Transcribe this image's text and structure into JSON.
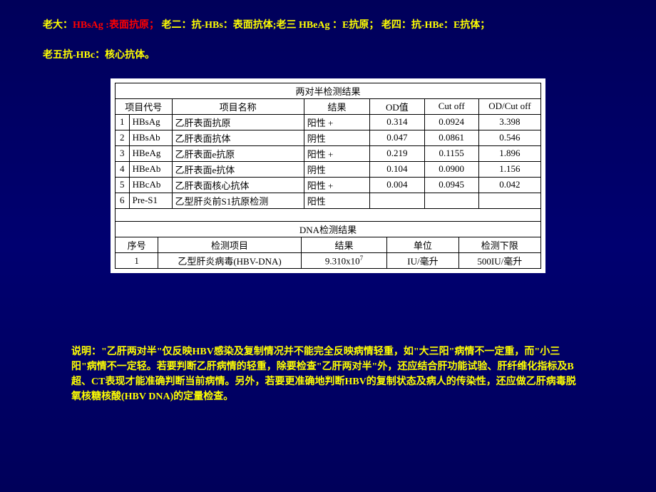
{
  "header": {
    "item1_label": "老大：",
    "item1_code": "HBsAg :表面抗原",
    "item1_sep": "；",
    "item2": "   老二：抗-HBs：表面抗体;",
    "item3": "老三 HBeAg ：E抗原；",
    "item4": "   老四：抗-HBe：E抗体；",
    "item5": "老五抗-HBc：核心抗体。"
  },
  "table1": {
    "title": "两对半检测结果",
    "headers": {
      "code": "项目代号",
      "name": "项目名称",
      "result": "结果",
      "od": "OD值",
      "cutoff": "Cut off",
      "ratio": "OD/Cut off"
    },
    "rows": [
      {
        "num": "1",
        "code": "HBsAg",
        "name": "乙肝表面抗原",
        "result": "阳性 +",
        "od": "0.314",
        "cutoff": "0.0924",
        "ratio": "3.398"
      },
      {
        "num": "2",
        "code": "HBsAb",
        "name": "乙肝表面抗体",
        "result": "阴性",
        "od": "0.047",
        "cutoff": "0.0861",
        "ratio": "0.546"
      },
      {
        "num": "3",
        "code": "HBeAg",
        "name": "乙肝表面e抗原",
        "result": "阳性 +",
        "od": "0.219",
        "cutoff": "0.1155",
        "ratio": "1.896"
      },
      {
        "num": "4",
        "code": "HBeAb",
        "name": "乙肝表面e抗体",
        "result": "阴性",
        "od": "0.104",
        "cutoff": "0.0900",
        "ratio": "1.156"
      },
      {
        "num": "5",
        "code": "HBcAb",
        "name": "乙肝表面核心抗体",
        "result": "阳性 +",
        "od": "0.004",
        "cutoff": "0.0945",
        "ratio": "0.042"
      },
      {
        "num": "6",
        "code": "Pre-S1",
        "name": "乙型肝炎前S1抗原检测",
        "result": "阳性",
        "od": "",
        "cutoff": "",
        "ratio": ""
      }
    ]
  },
  "table2": {
    "title": "DNA检测结果",
    "headers": {
      "seq": "序号",
      "item": "检测项目",
      "result": "结果",
      "unit": "单位",
      "limit": "检测下限"
    },
    "row": {
      "seq": "1",
      "item": "乙型肝炎病毒(HBV-DNA)",
      "result_base": "9.310x10",
      "result_exp": "7",
      "unit": "IU/毫升",
      "limit": "500IU/毫升"
    }
  },
  "explanation": "说明：\"乙肝两对半\"仅反映HBV感染及复制情况并不能完全反映病情轻重，如\"大三阳\"病情不一定重，而\"小三阳\"病情不一定轻。若要判断乙肝病情的轻重，除要检查\"乙肝两对半\"外，还应结合肝功能试验、肝纤维化指标及B超、CT表现才能准确判断当前病情。另外，若要更准确地判断HBV的复制状态及病人的传染性，还应做乙肝病毒脱氧核糖核酸(HBV DNA)的定量检查。"
}
